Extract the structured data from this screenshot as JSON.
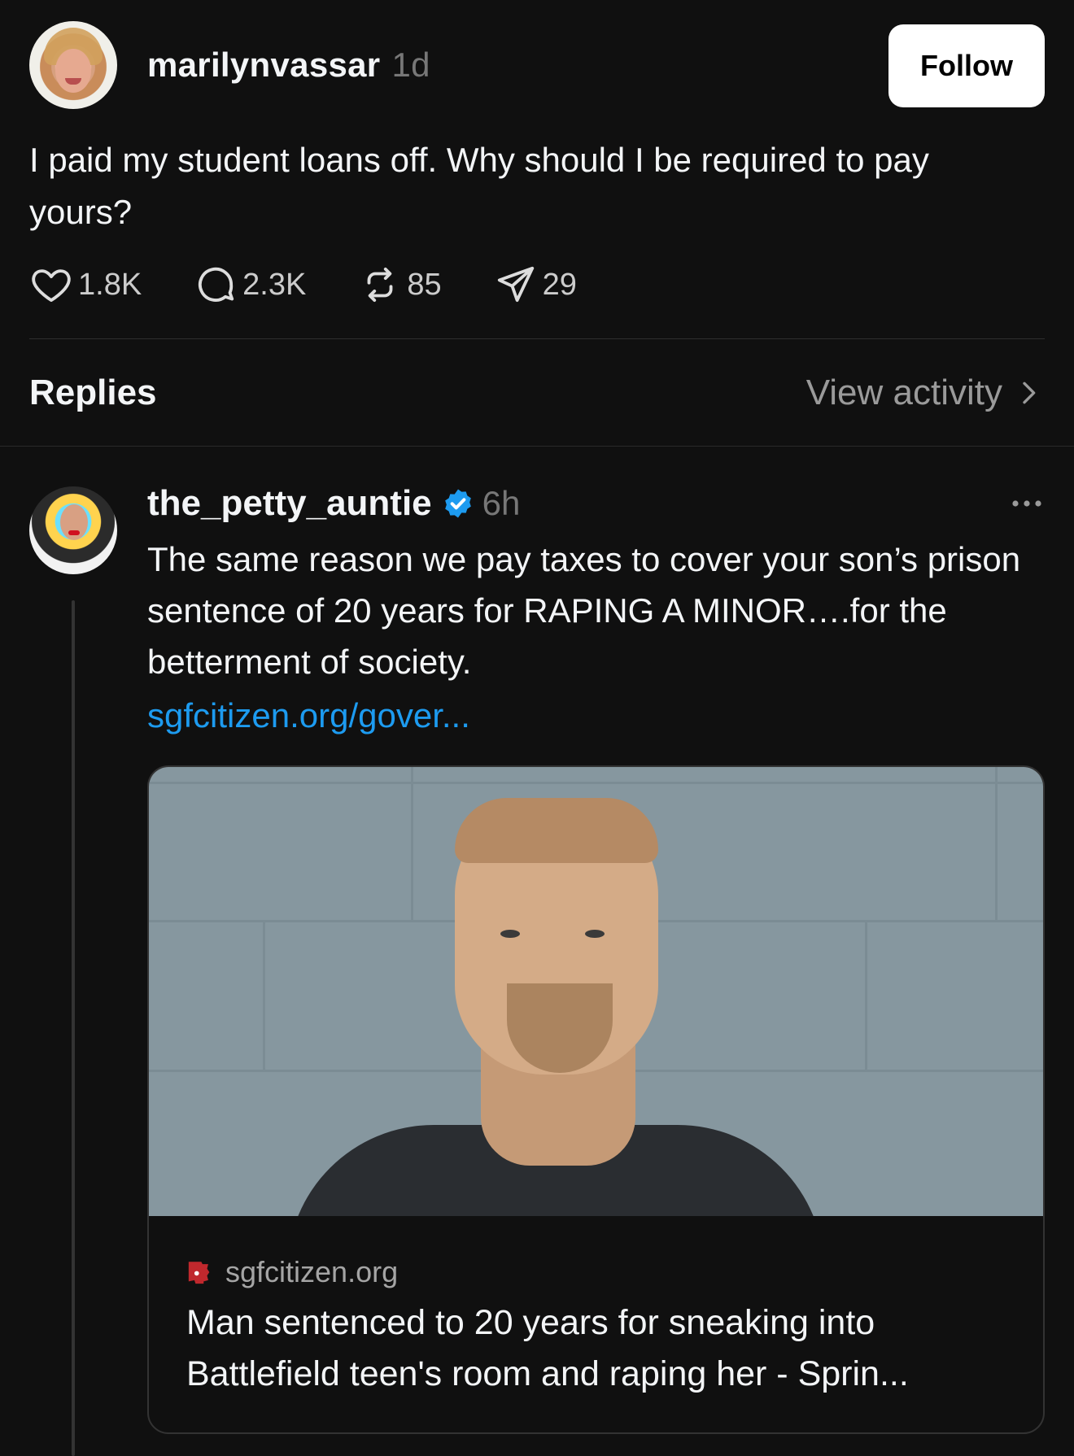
{
  "post": {
    "username": "marilynvassar",
    "time": "1d",
    "follow_label": "Follow",
    "text": "I paid my student loans off. Why should I be required to pay yours?",
    "likes": "1.8K",
    "comments": "2.3K",
    "reposts": "85",
    "shares": "29"
  },
  "replies_header": {
    "label": "Replies",
    "view_activity": "View activity"
  },
  "reply": {
    "username": "the_petty_auntie",
    "time": "6h",
    "text": "The same reason we pay taxes to cover your son’s prison sentence of 20 years for RAPING A MINOR….for the betterment of society.",
    "link": "sgfcitizen.org/gover...",
    "card": {
      "site": "sgfcitizen.org",
      "title": "Man sentenced to 20 years for sneaking into Battlefield teen's room and raping her - Sprin..."
    }
  },
  "colors": {
    "background": "#101010",
    "link": "#1d9bf0",
    "verified": "#1d9bf0",
    "muted": "#777777"
  },
  "icons": [
    "heart-icon",
    "comment-icon",
    "repost-icon",
    "share-icon",
    "chevron-right-icon",
    "verified-badge-icon",
    "more-icon",
    "site-favicon-icon"
  ]
}
